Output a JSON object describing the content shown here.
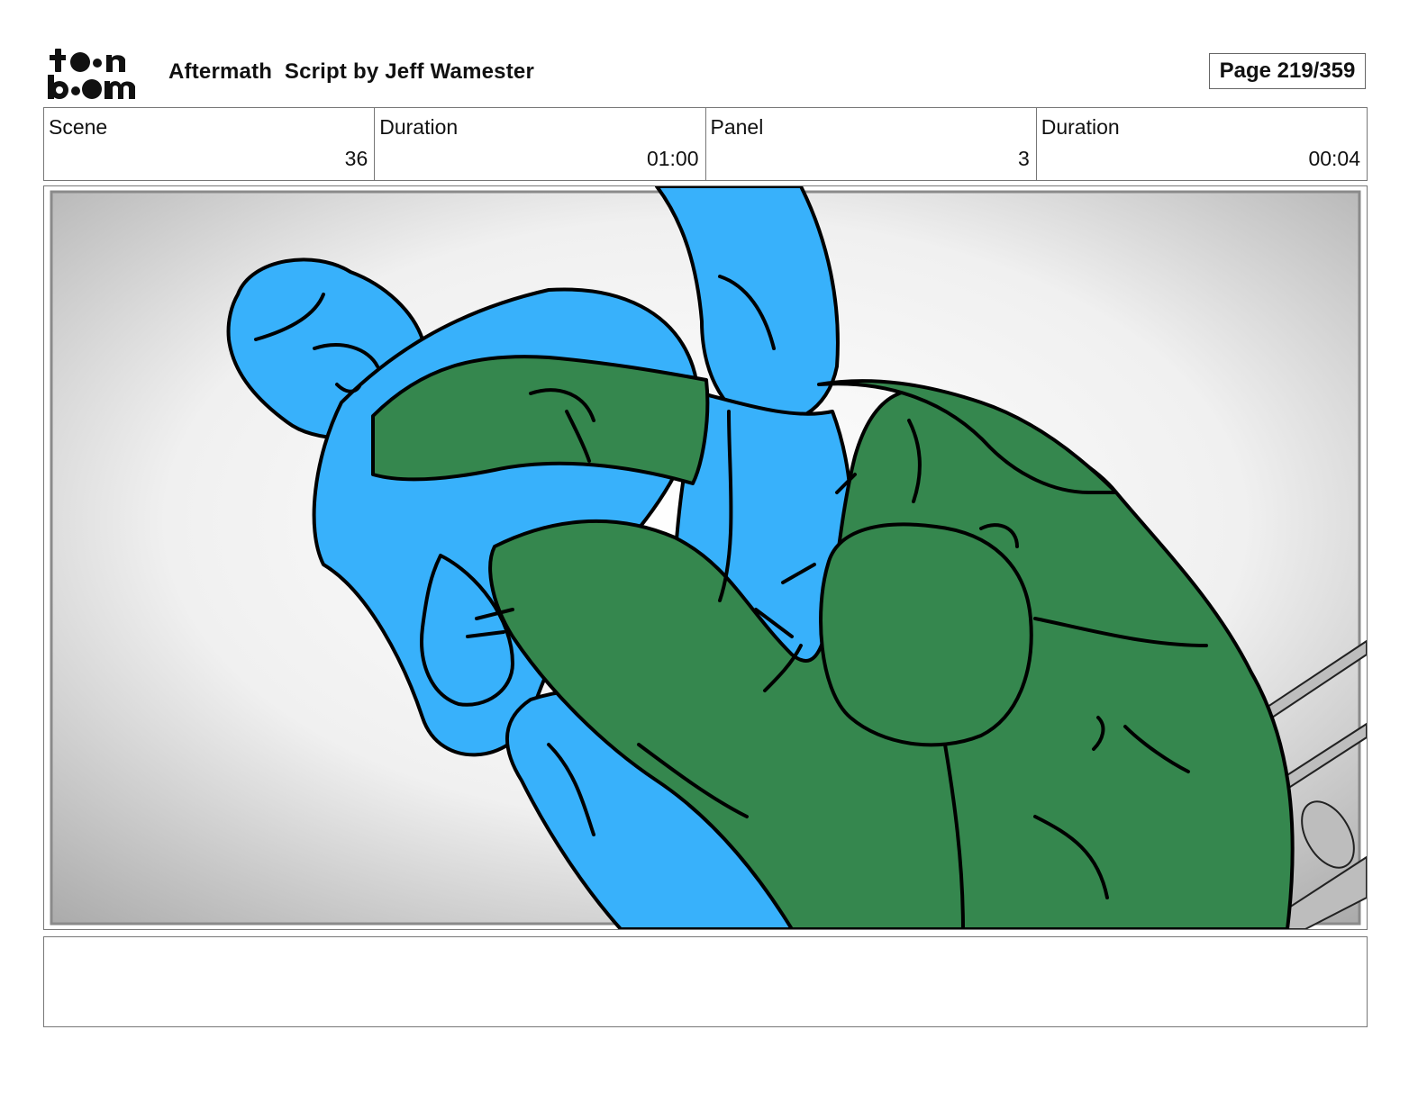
{
  "header": {
    "logo_icon": "toon-boom-logo",
    "title": "Aftermath  Script by Jeff Wamester",
    "page_label": "Page 219/359"
  },
  "info": {
    "scene_label": "Scene",
    "scene_value": "36",
    "scene_duration_label": "Duration",
    "scene_duration_value": "01:00",
    "panel_label": "Panel",
    "panel_value": "3",
    "panel_duration_label": "Duration",
    "panel_duration_value": "00:04"
  },
  "panel": {
    "image_icon": "storyboard-drawing",
    "figure_colors": {
      "blue_figure": "#38b1fb",
      "green_figure": "#35874e",
      "line": "#000000"
    }
  },
  "notes": {
    "text": ""
  }
}
